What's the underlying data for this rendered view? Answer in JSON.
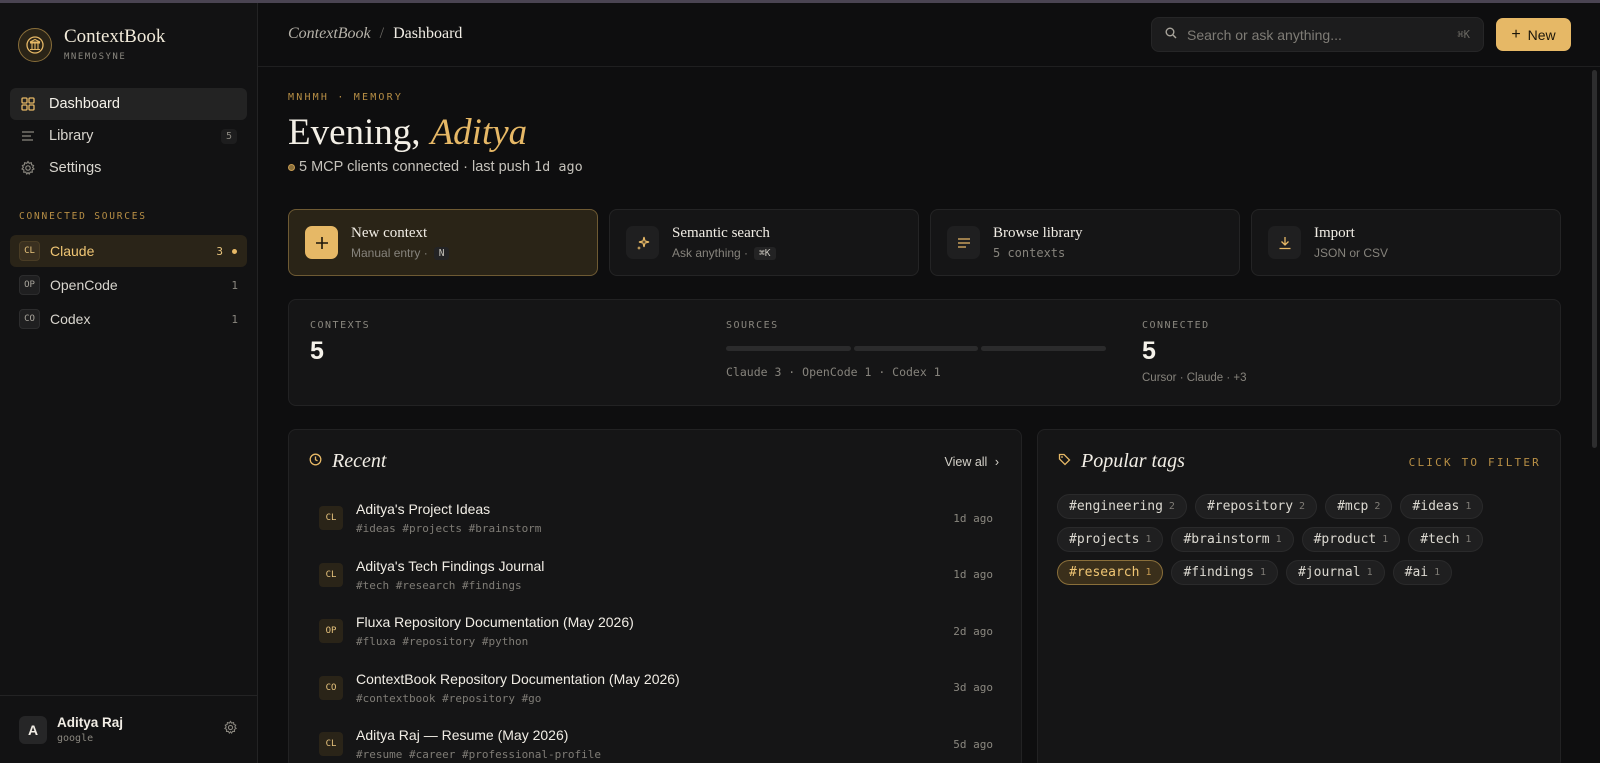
{
  "brand": {
    "name": "ContextBook",
    "sub": "MNEMOSYNE"
  },
  "nav": [
    {
      "label": "Dashboard",
      "icon": "grid-icon",
      "active": true
    },
    {
      "label": "Library",
      "icon": "list-icon",
      "count": "5"
    },
    {
      "label": "Settings",
      "icon": "gear-icon"
    }
  ],
  "sources_label": "CONNECTED SOURCES",
  "sources": [
    {
      "badge": "CL",
      "label": "Claude",
      "count": "3",
      "active": true
    },
    {
      "badge": "OP",
      "label": "OpenCode",
      "count": "1"
    },
    {
      "badge": "CO",
      "label": "Codex",
      "count": "1"
    }
  ],
  "user": {
    "initial": "A",
    "name": "Aditya Raj",
    "provider": "google"
  },
  "header": {
    "crumb_root": "ContextBook",
    "crumb_sep": "/",
    "crumb_current": "Dashboard",
    "search_placeholder": "Search or ask anything...",
    "search_shortcut": "⌘K",
    "new_label": "New"
  },
  "hero": {
    "eyebrow": "ΜΝΗΜΗ · MEMORY",
    "greeting": "Evening,",
    "name": "Aditya",
    "status_prefix": "5 MCP clients connected · last push ",
    "status_time": "1d ago"
  },
  "actions": [
    {
      "title": "New context",
      "sub": "Manual entry ·",
      "kbd": "N",
      "icon": "plus-icon"
    },
    {
      "title": "Semantic search",
      "sub": "Ask anything ·",
      "kbd": "⌘K",
      "icon": "sparkle-icon"
    },
    {
      "title": "Browse library",
      "sub": "5 contexts",
      "icon": "list-icon"
    },
    {
      "title": "Import",
      "sub": "JSON or CSV",
      "icon": "download-icon"
    }
  ],
  "stats": {
    "contexts_label": "CONTEXTS",
    "contexts_value": "5",
    "sources_label": "SOURCES",
    "sources_sub": "Claude 3 · OpenCode 1 · Codex 1",
    "source_shares": [
      3,
      1,
      1
    ],
    "connected_label": "CONNECTED",
    "connected_value": "5",
    "connected_sub": "Cursor · Claude · +3"
  },
  "recent": {
    "title": "Recent",
    "view_all": "View all",
    "items": [
      {
        "badge": "CL",
        "title": "Aditya's Project Ideas",
        "tags": "#ideas #projects #brainstorm",
        "time": "1d ago"
      },
      {
        "badge": "CL",
        "title": "Aditya's Tech Findings Journal",
        "tags": "#tech #research #findings",
        "time": "1d ago"
      },
      {
        "badge": "OP",
        "title": "Fluxa Repository Documentation (May 2026)",
        "tags": "#fluxa #repository #python",
        "time": "2d ago"
      },
      {
        "badge": "CO",
        "title": "ContextBook Repository Documentation (May 2026)",
        "tags": "#contextbook #repository #go",
        "time": "3d ago"
      },
      {
        "badge": "CL",
        "title": "Aditya Raj — Resume (May 2026)",
        "tags": "#resume #career #professional-profile",
        "time": "5d ago"
      }
    ]
  },
  "popular": {
    "title": "Popular tags",
    "filter_hint": "CLICK TO FILTER",
    "tags": [
      {
        "name": "#engineering",
        "count": "2"
      },
      {
        "name": "#repository",
        "count": "2"
      },
      {
        "name": "#mcp",
        "count": "2"
      },
      {
        "name": "#ideas",
        "count": "1"
      },
      {
        "name": "#projects",
        "count": "1"
      },
      {
        "name": "#brainstorm",
        "count": "1"
      },
      {
        "name": "#product",
        "count": "1"
      },
      {
        "name": "#tech",
        "count": "1"
      },
      {
        "name": "#research",
        "count": "1",
        "active": true
      },
      {
        "name": "#findings",
        "count": "1"
      },
      {
        "name": "#journal",
        "count": "1"
      },
      {
        "name": "#ai",
        "count": "1"
      }
    ]
  },
  "colors": {
    "accent": "#e6b866",
    "background": "#0e0e0f",
    "panel": "#151516"
  }
}
